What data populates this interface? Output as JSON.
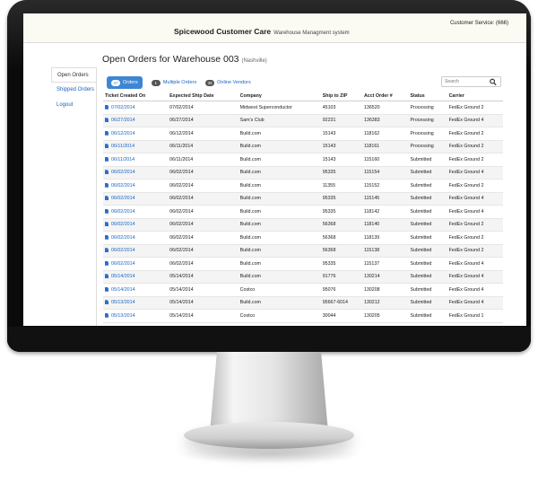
{
  "app": {
    "title": "Spicewood Customer Care",
    "subtitle": "Warehouse Managment system",
    "customer_service": "Customer Service: (666)"
  },
  "sidebar": {
    "items": [
      {
        "label": "Open Orders",
        "active": true
      },
      {
        "label": "Shipped Orders",
        "active": false
      },
      {
        "label": "Logout",
        "active": false
      }
    ]
  },
  "page": {
    "title": "Open Orders for Warehouse 003",
    "location": "(Nashville)"
  },
  "filters": [
    {
      "count": "47",
      "label": "Orders",
      "active": true
    },
    {
      "count": "1",
      "label": "Multiple Orders",
      "active": false
    },
    {
      "count": "35",
      "label": "Online Vendors",
      "active": false
    }
  ],
  "search": {
    "placeholder": "Search",
    "icon": "search-icon"
  },
  "table": {
    "columns": [
      "Ticket Created On",
      "Expected Ship Date",
      "Company",
      "Ship to ZIP",
      "Acct Order #",
      "Status",
      "Carrier"
    ],
    "rows": [
      [
        "07/02/2014",
        "07/02/2014",
        "Midwest Superconductor",
        "45103",
        "136520",
        "Processing",
        "FedEx Ground 2"
      ],
      [
        "06/27/2014",
        "06/27/2014",
        "Sam's Club",
        "92231",
        "136383",
        "Processing",
        "FedEx Ground 4"
      ],
      [
        "06/12/2014",
        "06/12/2014",
        "Build.com",
        "15143",
        "118162",
        "Processing",
        "FedEx Ground 2"
      ],
      [
        "06/11/2014",
        "06/11/2014",
        "Build.com",
        "15143",
        "118161",
        "Processing",
        "FedEx Ground 2"
      ],
      [
        "06/11/2014",
        "06/11/2014",
        "Build.com",
        "15143",
        "115160",
        "Submitted",
        "FedEx Ground 2"
      ],
      [
        "06/02/2014",
        "06/02/2014",
        "Build.com",
        "95335",
        "115154",
        "Submitted",
        "FedEx Ground 4"
      ],
      [
        "06/02/2014",
        "06/02/2014",
        "Build.com",
        "11355",
        "115152",
        "Submitted",
        "FedEx Ground 2"
      ],
      [
        "06/02/2014",
        "06/02/2014",
        "Build.com",
        "95335",
        "115145",
        "Submitted",
        "FedEx Ground 4"
      ],
      [
        "06/02/2014",
        "06/02/2014",
        "Build.com",
        "95335",
        "118142",
        "Submitted",
        "FedEx Ground 4"
      ],
      [
        "06/02/2014",
        "06/02/2014",
        "Build.com",
        "56368",
        "118140",
        "Submitted",
        "FedEx Ground 2"
      ],
      [
        "06/02/2014",
        "06/02/2014",
        "Build.com",
        "56368",
        "118139",
        "Submitted",
        "FedEx Ground 2"
      ],
      [
        "06/02/2014",
        "06/02/2014",
        "Build.com",
        "56368",
        "115138",
        "Submitted",
        "FedEx Ground 2"
      ],
      [
        "06/02/2014",
        "06/02/2014",
        "Build.com",
        "95335",
        "115137",
        "Submitted",
        "FedEx Ground 4"
      ],
      [
        "05/14/2014",
        "05/14/2014",
        "Build.com",
        "91776",
        "130214",
        "Submitted",
        "FedEx Ground 4"
      ],
      [
        "05/14/2014",
        "05/14/2014",
        "Costco",
        "95076",
        "130208",
        "Submitted",
        "FedEx Ground 4"
      ],
      [
        "05/13/2014",
        "05/14/2014",
        "Build.com",
        "95667-6014",
        "130212",
        "Submitted",
        "FedEx Ground 4"
      ],
      [
        "05/13/2014",
        "05/14/2014",
        "Costco",
        "30044",
        "130205",
        "Submitted",
        "FedEx Ground 1"
      ]
    ]
  },
  "colors": {
    "link": "#1a63c2",
    "active_pill": "#3e86d3",
    "header_bg": "#fbfaf3"
  }
}
